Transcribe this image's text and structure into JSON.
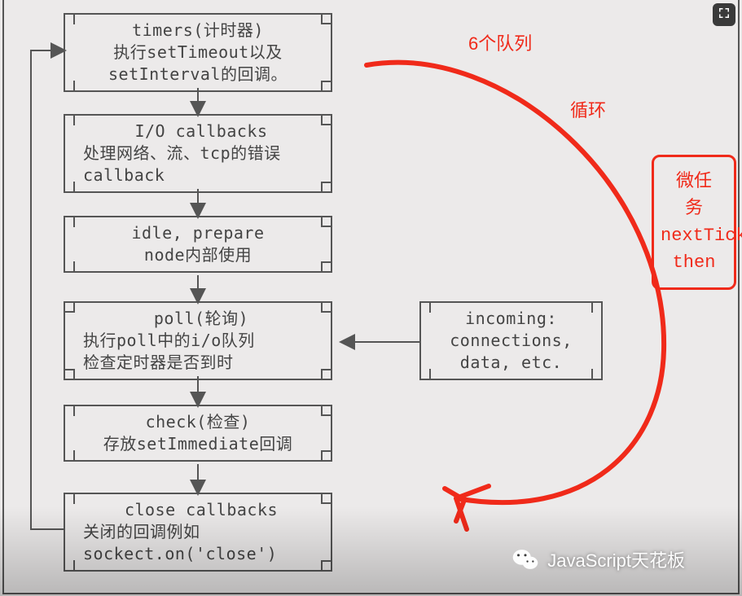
{
  "annotations": {
    "queues": "6个队列",
    "loop": "循环"
  },
  "phases": {
    "timers": {
      "title": "timers(计时器)",
      "line2": "执行setTimeout以及",
      "line3": "setInterval的回调。"
    },
    "io": {
      "title": "I/O callbacks",
      "line2": "处理网络、流、tcp的错误",
      "line3": "callback"
    },
    "idle": {
      "title": "idle, prepare",
      "line2": "node内部使用"
    },
    "poll": {
      "title": "poll(轮询)",
      "line2": "执行poll中的i/o队列",
      "line3": "检查定时器是否到时"
    },
    "check": {
      "title": "check(检查)",
      "line2": "存放setImmediate回调"
    },
    "close": {
      "title": "close callbacks",
      "line2": "关闭的回调例如",
      "line3": "sockect.on('close')"
    }
  },
  "incoming": {
    "line1": "incoming:",
    "line2": "connections,",
    "line3": "data, etc."
  },
  "microtask": {
    "line1": "微任",
    "line2": "务",
    "line3": "nextTick",
    "line4": "then"
  },
  "watermark": "JavaScript天花板",
  "colors": {
    "accent_red": "#f02a1a",
    "box_border": "#555555",
    "background": "#eceaea"
  }
}
